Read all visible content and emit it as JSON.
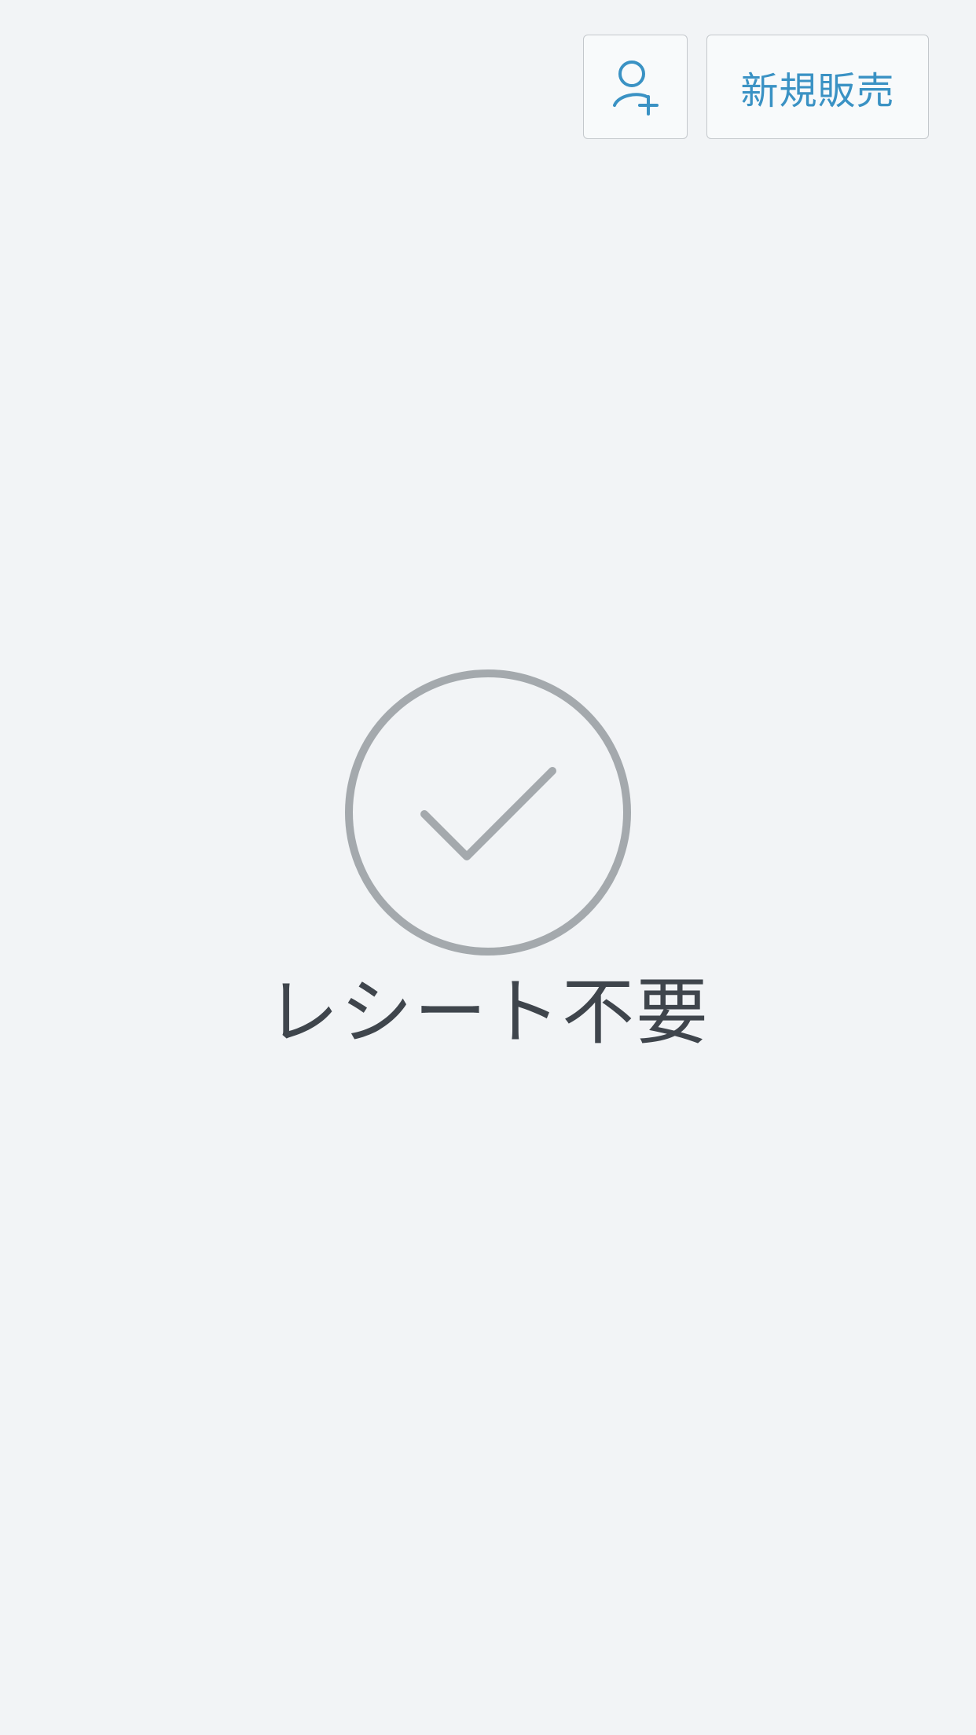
{
  "header": {
    "add_customer_icon": "person-add-icon",
    "new_sale_label": "新規販売"
  },
  "status": {
    "icon": "check-circle-icon",
    "label": "レシート不要"
  },
  "colors": {
    "background": "#f2f4f6",
    "accent": "#3a92c4",
    "icon_gray": "#a4a9ad",
    "text": "#3f454c"
  }
}
